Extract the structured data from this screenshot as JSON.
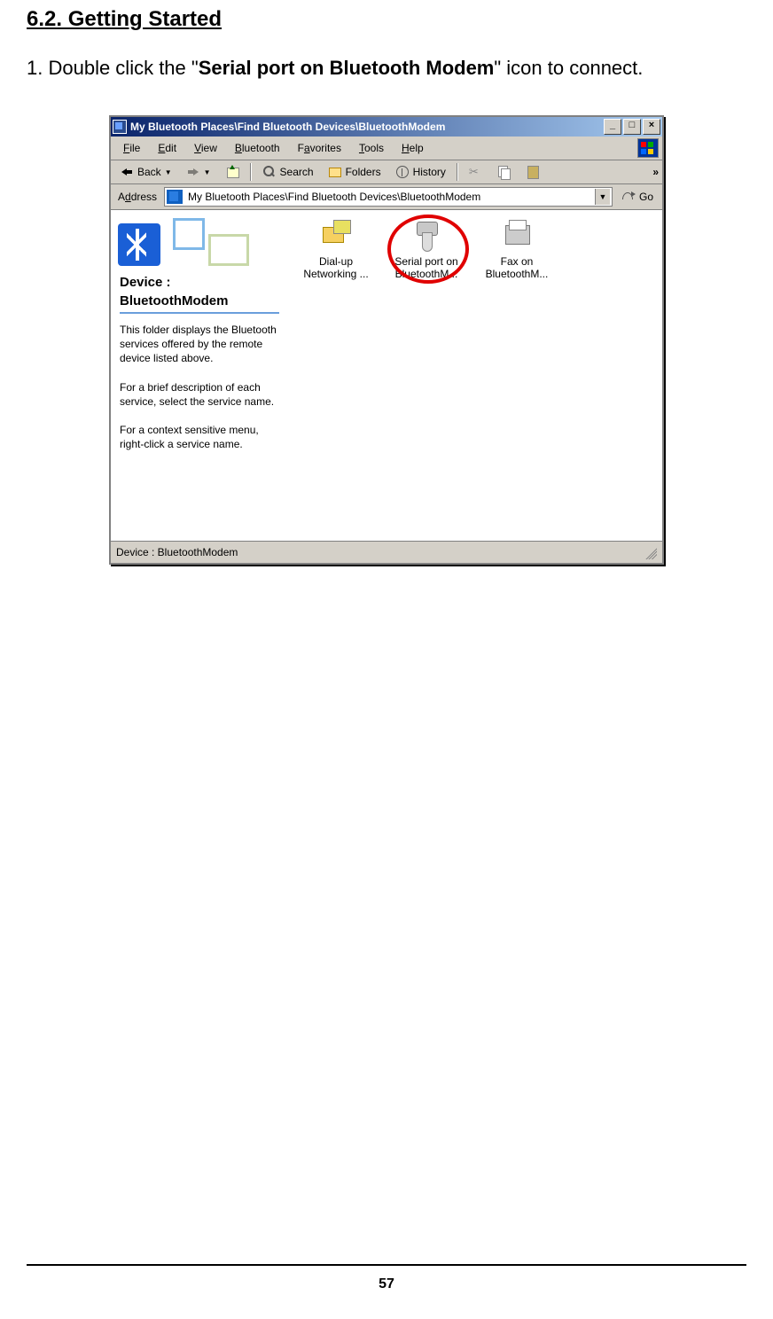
{
  "doc": {
    "heading": "6.2. Getting Started",
    "step_num": "1.",
    "step_pre": "  Double click the \"",
    "step_bold": "Serial port on Bluetooth Modem",
    "step_post": "\" icon to connect.",
    "page_number": "57"
  },
  "win": {
    "title": "My Bluetooth Places\\Find Bluetooth Devices\\BluetoothModem",
    "controls": {
      "min": "_",
      "max": "□",
      "close": "×"
    },
    "menu": {
      "file": "File",
      "file_u": "F",
      "edit": "Edit",
      "edit_u": "E",
      "view": "View",
      "view_u": "V",
      "bluetooth": "Bluetooth",
      "bluetooth_u": "B",
      "favorites": "Favorites",
      "favorites_u": "a",
      "tools": "Tools",
      "tools_u": "T",
      "help": "Help",
      "help_u": "H"
    },
    "toolbar": {
      "back": "Back",
      "search": "Search",
      "folders": "Folders",
      "history": "History"
    },
    "address_label": "Address",
    "address_value": "My Bluetooth Places\\Find Bluetooth Devices\\BluetoothModem",
    "go": "Go",
    "sidebar": {
      "device_lbl": "Device :",
      "device_name": "BluetoothModem",
      "p1": "This folder displays the Bluetooth services offered by the remote device listed above.",
      "p2": "For a brief description of each service, select the service name.",
      "p3": "For a context sensitive menu, right-click a service name."
    },
    "items": {
      "dialup_l1": "Dial-up",
      "dialup_l2": "Networking ...",
      "serial_l1": "Serial port on",
      "serial_l2": "BluetoothM...",
      "fax_l1": "Fax on",
      "fax_l2": "BluetoothM..."
    },
    "status": "Device : BluetoothModem"
  }
}
